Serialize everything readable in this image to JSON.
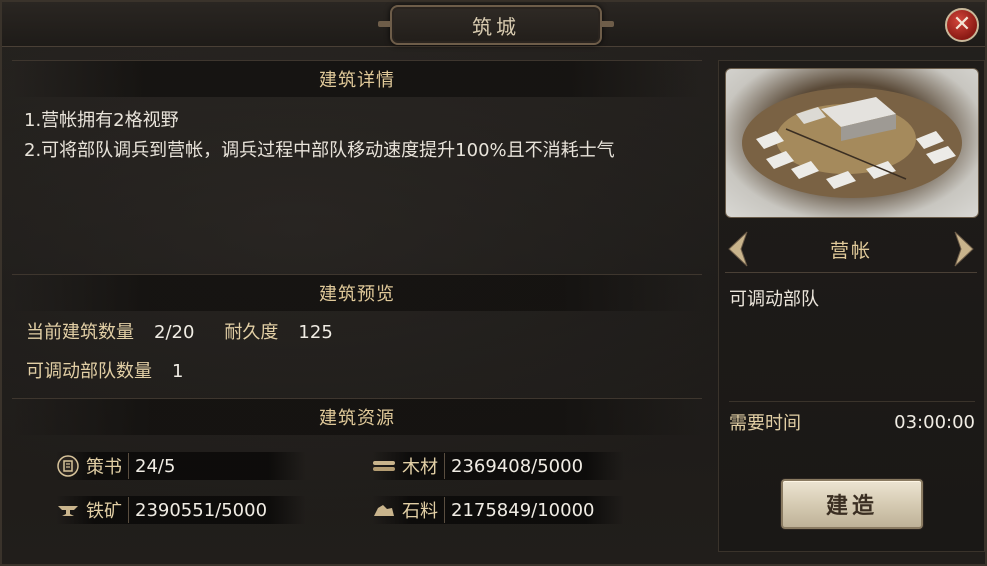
{
  "window": {
    "title": "筑城",
    "close_label": "✕"
  },
  "details": {
    "header": "建筑详情",
    "lines": [
      "1.营帐拥有2格视野",
      "2.可将部队调兵到营帐，调兵过程中部队移动速度提升100%且不消耗士气"
    ]
  },
  "preview_section": {
    "header": "建筑预览",
    "current_count_label": "当前建筑数量",
    "current_count_value": "2/20",
    "durability_label": "耐久度",
    "durability_value": "125",
    "troop_count_label": "可调动部队数量",
    "troop_count_value": "1"
  },
  "resources": {
    "header": "建筑资源",
    "items": [
      {
        "icon": "strategy-book-icon",
        "label": "策书",
        "value": "24/5"
      },
      {
        "icon": "wood-icon",
        "label": "木材",
        "value": "2369408/5000"
      },
      {
        "icon": "iron-ore-icon",
        "label": "铁矿",
        "value": "2390551/5000"
      },
      {
        "icon": "stone-icon",
        "label": "石料",
        "value": "2175849/10000"
      }
    ]
  },
  "building": {
    "name": "营帐",
    "description": "可调动部队",
    "time_label": "需要时间",
    "time_value": "03:00:00",
    "build_button": "建造"
  },
  "colors": {
    "accent_gold": "#e0c999",
    "text_light": "#f0ece4",
    "close_red": "#b8322a"
  }
}
